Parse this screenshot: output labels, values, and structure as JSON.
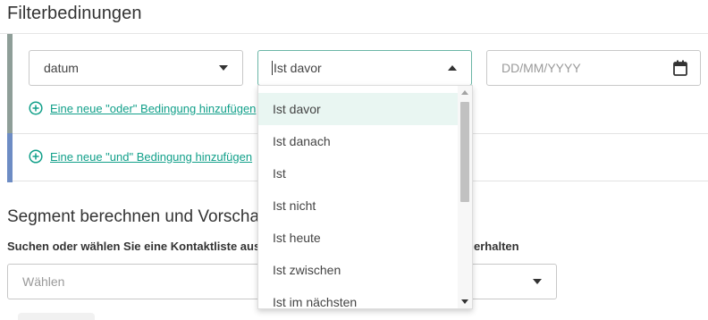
{
  "page": {
    "title": "Filterbedinungen"
  },
  "or_group": {
    "field_select": {
      "value": "datum"
    },
    "operator_select": {
      "value": "Ist davor"
    },
    "date_input": {
      "placeholder": "DD/MM/YYYY"
    },
    "add_or_link": "Eine neue \"oder\" Bedingung hinzufügen"
  },
  "and_group": {
    "add_and_link": "Eine neue \"und\" Bedingung hinzufügen"
  },
  "dropdown": {
    "options": [
      "Ist davor",
      "Ist danach",
      "Ist",
      "Ist nicht",
      "Ist heute",
      "Ist zwischen",
      "Ist im nächsten"
    ],
    "highlighted": "Ist davor"
  },
  "segment": {
    "heading": "Segment berechnen und Vorschau",
    "hint_left": "Suchen oder wählen Sie eine Kontaktliste aus",
    "hint_right": "erhalten",
    "list_select": {
      "placeholder": "Wählen"
    }
  },
  "colors": {
    "accent": "#12a08a",
    "or_bar": "#8e9e98",
    "and_bar": "#6d8cc4",
    "highlight": "#e9f6f2"
  },
  "icons": {
    "calendar": "calendar-icon",
    "add": "plus-circle-icon"
  }
}
